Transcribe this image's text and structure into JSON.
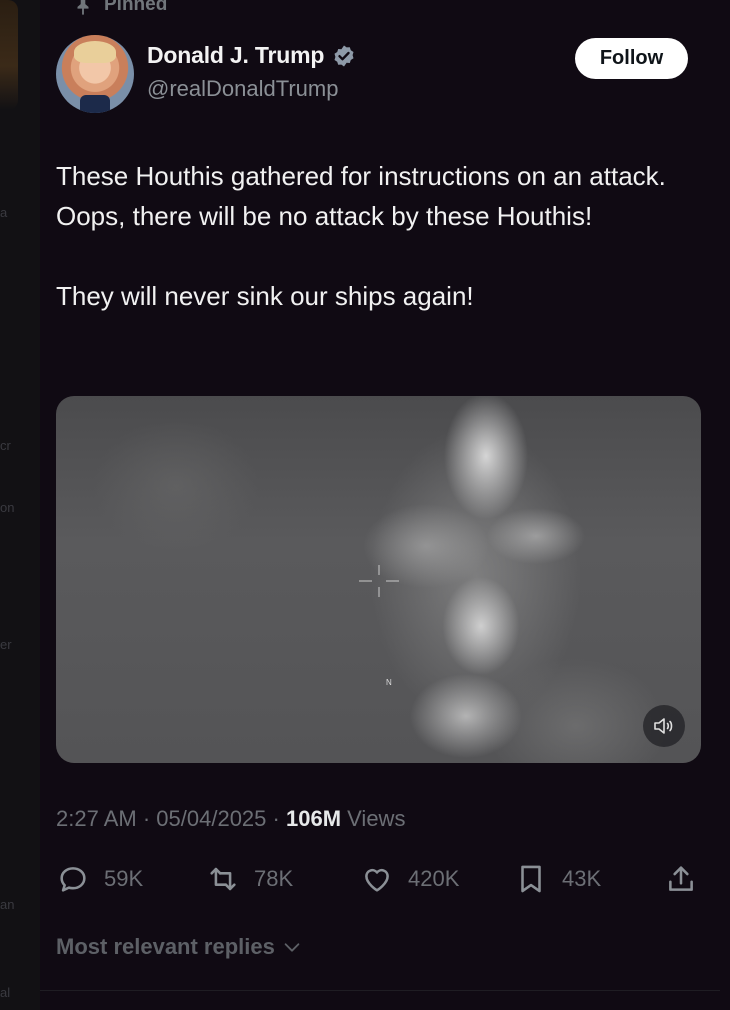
{
  "background": {
    "fragments": [
      "a",
      "cr",
      "on",
      "er",
      "an",
      "al"
    ]
  },
  "pinned_label": "Pinned",
  "author": {
    "name": "Donald J. Trump",
    "handle": "@realDonaldTrump"
  },
  "follow_label": "Follow",
  "tweet": {
    "paragraphs": [
      "These Houthis gathered for instructions on an attack. Oops, there will be no attack by these Houthis!",
      "They will never sink our ships again!"
    ]
  },
  "media": {
    "north_marker": "N",
    "sound_icon": "speaker-muted-icon"
  },
  "meta": {
    "time": "2:27 AM",
    "date": "05/04/2025",
    "separator": "·",
    "views_count": "106M",
    "views_label": "Views"
  },
  "actions": {
    "replies": "59K",
    "reposts": "78K",
    "likes": "420K",
    "bookmarks": "43K"
  },
  "replies_sort": "Most relevant replies",
  "colors": {
    "background": "#100a13",
    "follow_button": "#ffffff",
    "verified": "#8e9aa8",
    "muted_text": "#6c6f75"
  }
}
